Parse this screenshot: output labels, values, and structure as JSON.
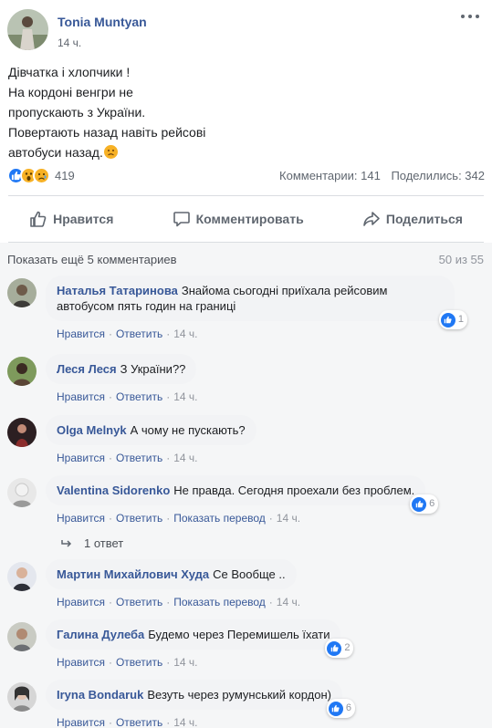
{
  "post": {
    "author": "Tonia Muntyan",
    "time": "14 ч.",
    "body_lines": [
      "Дівчатка і хлопчики !",
      "На кордоні венгри не",
      "пропускають з України.",
      "Повертають назад навіть рейсові",
      "автобуси назад."
    ],
    "reaction_icons": [
      "like-icon",
      "wow-icon",
      "sad-icon"
    ],
    "reaction_count": "419",
    "comments_stat": "Комментарии: 141",
    "shares_stat": "Поделились: 342"
  },
  "actions": {
    "like": "Нравится",
    "comment": "Комментировать",
    "share": "Поделиться"
  },
  "comments_header": {
    "more_label": "Показать ещё 5 комментариев",
    "count_label": "50 из 55"
  },
  "comment_links": {
    "like": "Нравится",
    "reply": "Ответить",
    "translate": "Показать перевод"
  },
  "comments": [
    {
      "name": "Наталья Татаринова",
      "text": "Знайома сьогодні приїхала рейсовим",
      "text2": "автобусом пять годин на границі",
      "likes": "1",
      "time": "14 ч."
    },
    {
      "name": "Леся Леся",
      "text": "З України??",
      "time": "14 ч."
    },
    {
      "name": "Olga Melnyk",
      "text": "А чому не пускають?",
      "time": "14 ч."
    },
    {
      "name": "Valentina Sidorenko",
      "text": "Не правда. Сегодня проехали без проблем.",
      "likes": "6",
      "time": "14 ч."
    },
    {
      "name": "Мартин Михайлович Худа",
      "text": "Се Вообще ..",
      "time": "14 ч."
    },
    {
      "name": "Галина Дулеба",
      "text": "Будемо через Перемишель їхати",
      "likes": "2",
      "time": "14 ч."
    },
    {
      "name": "Iryna Bondaruk",
      "text": "Везуть через румунський кордон)",
      "likes": "6",
      "time": "14 ч."
    }
  ],
  "replies": {
    "label": "1 ответ"
  }
}
